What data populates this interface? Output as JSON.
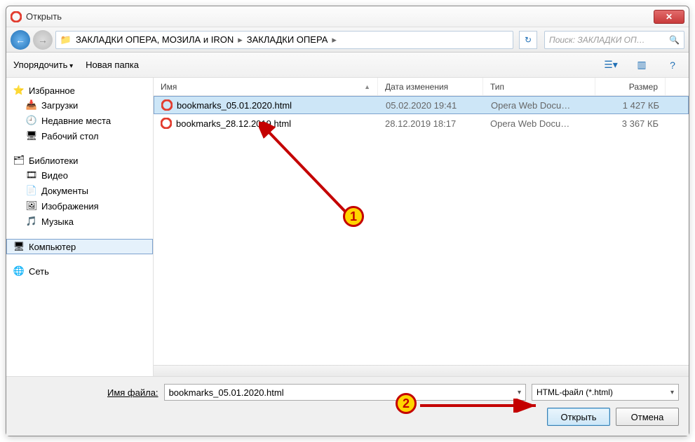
{
  "window": {
    "title": "Открыть"
  },
  "breadcrumb": {
    "seg1": "ЗАКЛАДКИ ОПЕРА,  МОЗИЛА и IRON",
    "seg2": "ЗАКЛАДКИ ОПЕРА"
  },
  "search": {
    "placeholder": "Поиск: ЗАКЛАДКИ ОП…"
  },
  "toolbar": {
    "organize": "Упорядочить",
    "new_folder": "Новая папка"
  },
  "sidebar": {
    "favorites_label": "Избранное",
    "favorites": [
      {
        "icon": "📥",
        "label": "Загрузки"
      },
      {
        "icon": "🕘",
        "label": "Недавние места"
      },
      {
        "icon": "🖥",
        "label": "Рабочий стол"
      }
    ],
    "libraries_label": "Библиотеки",
    "libraries": [
      {
        "icon": "🎞",
        "label": "Видео"
      },
      {
        "icon": "📄",
        "label": "Документы"
      },
      {
        "icon": "🖼",
        "label": "Изображения"
      },
      {
        "icon": "🎵",
        "label": "Музыка"
      }
    ],
    "computer_label": "Компьютер",
    "network_label": "Сеть"
  },
  "columns": {
    "name": "Имя",
    "date": "Дата изменения",
    "type": "Тип",
    "size": "Размер"
  },
  "files": [
    {
      "name": "bookmarks_05.01.2020.html",
      "date": "05.02.2020 19:41",
      "type": "Opera Web Docu…",
      "size": "1 427 КБ",
      "selected": true
    },
    {
      "name": "bookmarks_28.12.2019.html",
      "date": "28.12.2019 18:17",
      "type": "Opera Web Docu…",
      "size": "3 367 КБ",
      "selected": false
    }
  ],
  "footer": {
    "filename_label": "Имя файла:",
    "filename_value": "bookmarks_05.01.2020.html",
    "filetype": "HTML-файл (*.html)",
    "open": "Открыть",
    "cancel": "Отмена"
  },
  "annotations": {
    "n1": "1",
    "n2": "2"
  }
}
